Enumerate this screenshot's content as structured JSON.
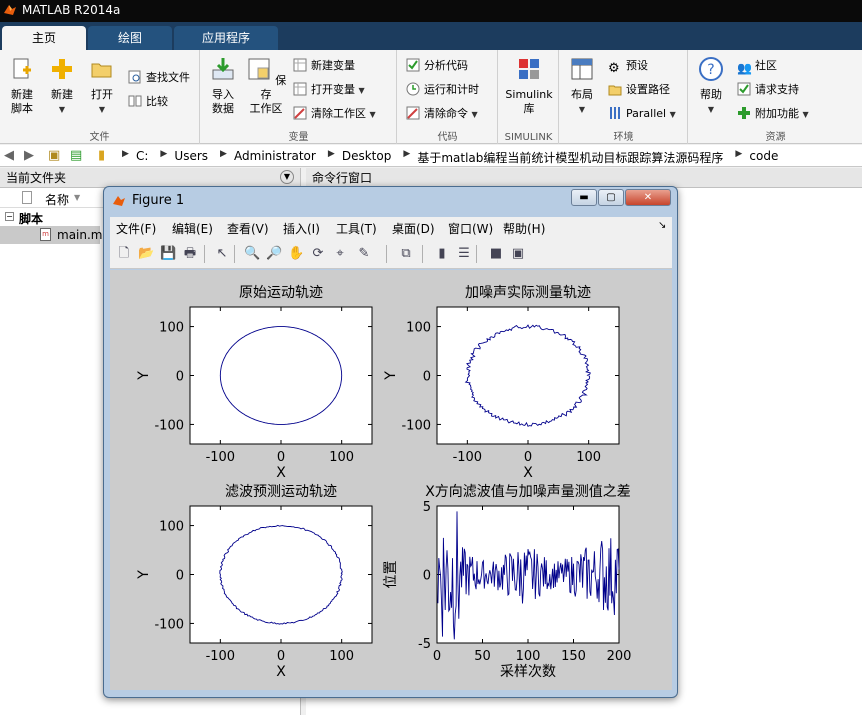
{
  "app": {
    "title": "MATLAB R2014a"
  },
  "tabs": [
    "主页",
    "绘图",
    "应用程序"
  ],
  "ribbon": {
    "file": {
      "new_script": "新建\n脚本",
      "new": "新建",
      "open": "打开",
      "find_files": "查找文件",
      "compare": "比较",
      "label": "文件"
    },
    "variable": {
      "import": "导入\n数据",
      "save_ws": "保存\n工作区",
      "new_var": "新建变量",
      "open_var": "打开变量",
      "clear_ws": "清除工作区",
      "label": "变量"
    },
    "code": {
      "analyze": "分析代码",
      "run_time": "运行和计时",
      "clear_cmd": "清除命令",
      "label": "代码"
    },
    "simulink": {
      "lib": "Simulink\n库",
      "label": "SIMULINK"
    },
    "env": {
      "layout": "布局",
      "prefs": "预设",
      "set_path": "设置路径",
      "parallel": "Parallel",
      "label": "环境"
    },
    "resources": {
      "help": "帮助",
      "community": "社区",
      "support": "请求支持",
      "addons": "附加功能",
      "label": "资源"
    }
  },
  "address": {
    "crumbs": [
      "C:",
      "Users",
      "Administrator",
      "Desktop",
      "基于matlab编程当前统计模型机动目标跟踪算法源码程序",
      "code"
    ]
  },
  "current_folder": {
    "title": "当前文件夹",
    "col_name": "名称",
    "group": "脚本",
    "files": [
      "main.m"
    ]
  },
  "command_window": {
    "title": "命令行窗口"
  },
  "figure": {
    "title": "Figure 1",
    "menus": [
      "文件(F)",
      "编辑(E)",
      "查看(V)",
      "插入(I)",
      "工具(T)",
      "桌面(D)",
      "窗口(W)",
      "帮助(H)"
    ],
    "tools": [
      "new-figure-icon",
      "open-file-icon",
      "save-icon",
      "print-icon",
      "pointer-icon",
      "zoom-in-icon",
      "zoom-out-icon",
      "pan-icon",
      "rotate-icon",
      "data-cursor-icon",
      "brush-icon",
      "link-icon",
      "colorbar-icon",
      "legend-icon",
      "hide-plot-tools-icon",
      "show-plot-tools-icon"
    ]
  },
  "chart_data": [
    {
      "type": "line",
      "title": "原始运动轨迹",
      "xlabel": "X",
      "ylabel": "Y",
      "xlim": [
        -150,
        150
      ],
      "ylim": [
        -140,
        140
      ],
      "xticks": [
        -100,
        0,
        100
      ],
      "yticks": [
        -100,
        0,
        100
      ],
      "series": [
        {
          "shape": "ellipse",
          "center": [
            0,
            0
          ],
          "rx": 100,
          "ry": 100,
          "noise": 0
        }
      ]
    },
    {
      "type": "line",
      "title": "加噪声实际测量轨迹",
      "xlabel": "X",
      "ylabel": "Y",
      "xlim": [
        -150,
        150
      ],
      "ylim": [
        -140,
        140
      ],
      "xticks": [
        -100,
        0,
        100
      ],
      "yticks": [
        -100,
        0,
        100
      ],
      "series": [
        {
          "shape": "ellipse",
          "center": [
            0,
            0
          ],
          "rx": 100,
          "ry": 100,
          "noise": 4
        }
      ]
    },
    {
      "type": "line",
      "title": "滤波预测运动轨迹",
      "xlabel": "X",
      "ylabel": "Y",
      "xlim": [
        -150,
        150
      ],
      "ylim": [
        -140,
        140
      ],
      "xticks": [
        -100,
        0,
        100
      ],
      "yticks": [
        -100,
        0,
        100
      ],
      "series": [
        {
          "shape": "ellipse",
          "center": [
            0,
            0
          ],
          "rx": 100,
          "ry": 100,
          "noise": 1.5
        }
      ]
    },
    {
      "type": "line",
      "title": "X方向滤波值与加噪声量测值之差",
      "xlabel": "采样次数",
      "ylabel": "位置",
      "xlim": [
        0,
        200
      ],
      "ylim": [
        -5,
        5
      ],
      "xticks": [
        0,
        50,
        100,
        150,
        200
      ],
      "yticks": [
        -5,
        0,
        5
      ],
      "series": [
        {
          "n": 200,
          "amp_start": 5,
          "amp_mid": 1.6,
          "amp_end": 3
        }
      ]
    }
  ],
  "colors": {
    "line": "#00008b",
    "figure_bg": "#cccccc",
    "axes_bg": "#ffffff"
  }
}
